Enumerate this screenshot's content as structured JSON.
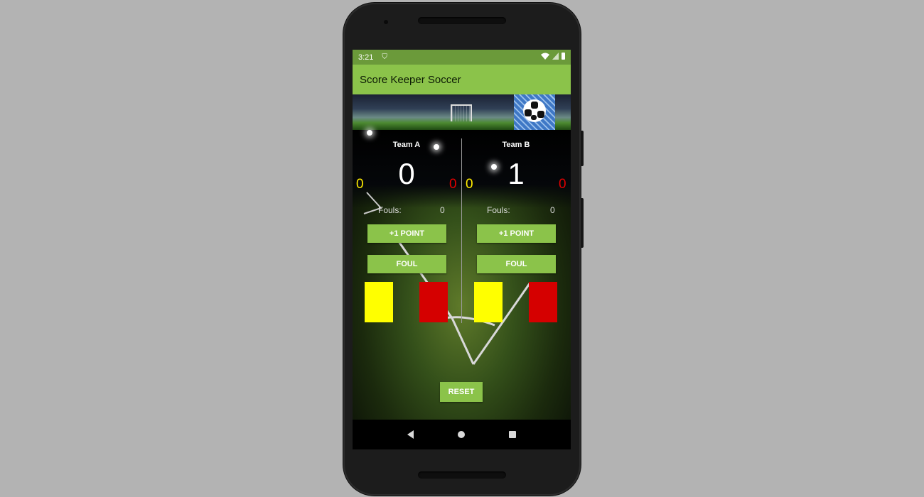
{
  "status_bar": {
    "time": "3:21"
  },
  "app_bar": {
    "title": "Score Keeper Soccer"
  },
  "team_a": {
    "name": "Team A",
    "score": "0",
    "yellow_cards": "0",
    "red_cards": "0",
    "fouls_label": "Fouls:",
    "fouls": "0",
    "point_button": "+1 POINT",
    "foul_button": "FOUL"
  },
  "team_b": {
    "name": "Team B",
    "score": "1",
    "yellow_cards": "0",
    "red_cards": "0",
    "fouls_label": "Fouls:",
    "fouls": "0",
    "point_button": "+1 POINT",
    "foul_button": "FOUL"
  },
  "reset_button": "RESET",
  "colors": {
    "accent": "#8bc34a",
    "status_bar": "#6b9a3a",
    "yellow_card": "#ffff00",
    "red_card": "#d50000"
  },
  "icons": [
    "shield-icon",
    "wifi-icon",
    "signal-icon",
    "battery-icon",
    "back-icon",
    "home-icon",
    "recents-icon"
  ]
}
